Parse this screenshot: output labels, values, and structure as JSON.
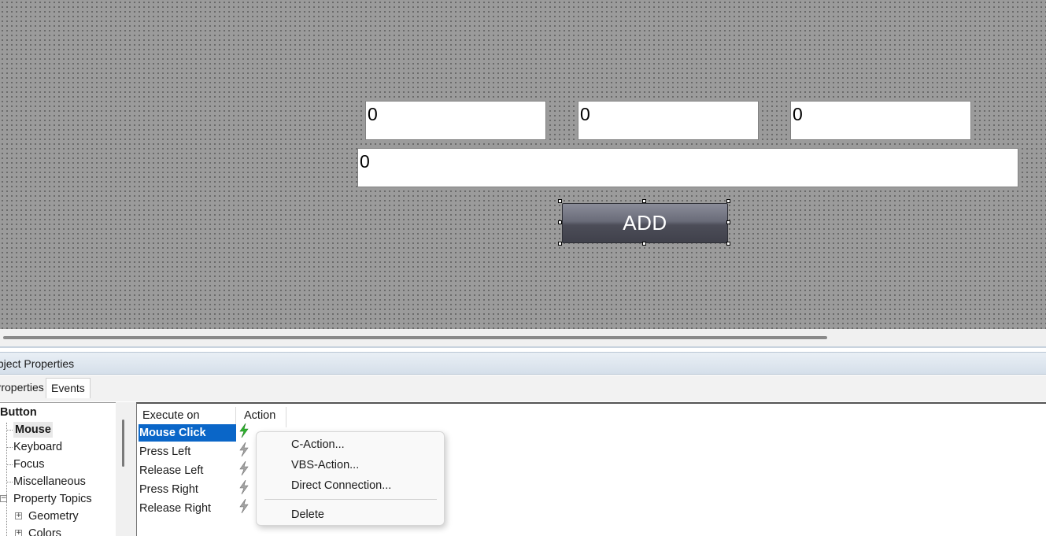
{
  "canvas": {
    "fields": [
      "0",
      "0",
      "0",
      "0"
    ],
    "button_label": "ADD"
  },
  "properties_window": {
    "title": "Object Properties",
    "tabs": [
      "Properties",
      "Events"
    ],
    "active_tab": "Events",
    "tree": {
      "root": "Button",
      "items": [
        "Mouse",
        "Keyboard",
        "Focus",
        "Miscellaneous",
        "Property Topics",
        "Geometry",
        "Colors"
      ],
      "selected": "Mouse"
    },
    "events_table": {
      "columns": [
        "Execute on",
        "Action"
      ],
      "rows": [
        "Mouse Click",
        "Press Left",
        "Release Left",
        "Press Right",
        "Release Right"
      ],
      "selected_row": "Mouse Click"
    }
  },
  "context_menu": {
    "items": [
      "C-Action...",
      "VBS-Action...",
      "Direct Connection...",
      "Delete"
    ]
  },
  "colors": {
    "canvas_bg": "#9b9b9b",
    "selection": "#0a66c8",
    "bolt_active": "#2fb52f",
    "bolt_inactive": "#9a9a9a"
  }
}
